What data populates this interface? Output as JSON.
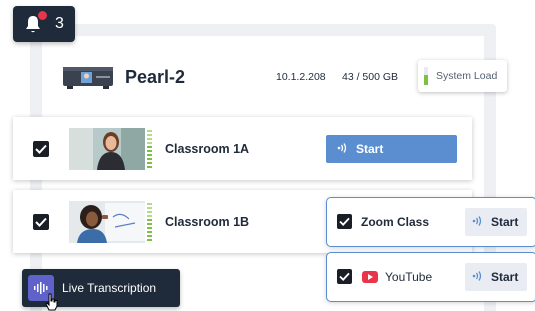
{
  "notifications": {
    "count": "3",
    "icon": "bell-icon"
  },
  "device": {
    "name": "Pearl-2",
    "ip": "10.1.2.208",
    "storage": "43 / 500 GB",
    "system_load_label": "System Load",
    "system_load_level": 0.55
  },
  "channels": [
    {
      "name": "Classroom 1A",
      "checked": true,
      "action_label": "Start"
    },
    {
      "name": "Classroom 1B",
      "checked": true
    }
  ],
  "destinations": [
    {
      "name": "Zoom Class",
      "checked": true,
      "action_label": "Start"
    },
    {
      "name": "YouTube",
      "checked": true,
      "action_label": "Start",
      "icon": "youtube-icon"
    }
  ],
  "transcription": {
    "label": "Live Transcription",
    "icon": "waveform-icon"
  },
  "colors": {
    "accent": "#5a8ed0",
    "dark": "#1f2a3a",
    "level_green": "#7cc142",
    "notification_red": "#e8354a",
    "transcription_purple": "#5f62c8"
  }
}
